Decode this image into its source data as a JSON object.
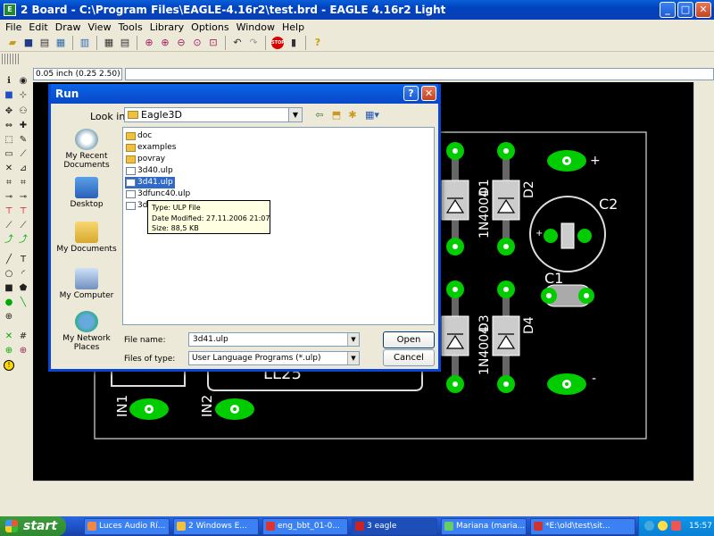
{
  "window": {
    "title": "2 Board - C:\\Program Files\\EAGLE-4.16r2\\test.brd - EAGLE 4.16r2 Light"
  },
  "menu": [
    "File",
    "Edit",
    "Draw",
    "View",
    "Tools",
    "Library",
    "Options",
    "Window",
    "Help"
  ],
  "coord_readout": "0.05 inch (0.25 2.50)",
  "pcb": {
    "labels": {
      "d1": "1N4004",
      "d1_ref": "D1",
      "d2_ref": "D2",
      "c2": "C2",
      "c1": "C1",
      "d3": "1N4004",
      "d3_ref": "D3",
      "d4_ref": "D4",
      "plus": "+",
      "minus": "-",
      "in1": "IN1",
      "in2": "IN2",
      "ll": "LL25"
    }
  },
  "dialog": {
    "title": "Run",
    "look_in_label": "Look in:",
    "look_in_value": "Eagle3D",
    "places": [
      "My Recent Documents",
      "Desktop",
      "My Documents",
      "My Computer",
      "My Network Places"
    ],
    "files": [
      {
        "name": "doc",
        "type": "folder"
      },
      {
        "name": "examples",
        "type": "folder"
      },
      {
        "name": "povray",
        "type": "folder"
      },
      {
        "name": "3d40.ulp",
        "type": "file"
      },
      {
        "name": "3d41.ulp",
        "type": "file",
        "selected": true
      },
      {
        "name": "3dfunc40.ulp",
        "type": "file"
      },
      {
        "name": "3df",
        "type": "file"
      }
    ],
    "tooltip": {
      "type": "Type: ULP File",
      "modified": "Date Modified: 27.11.2006 21:07",
      "size": "Size: 88,5 KB"
    },
    "file_name_label": "File name:",
    "file_name_value": "3d41.ulp",
    "files_of_type_label": "Files of type:",
    "files_of_type_value": "User Language Programs (*.ulp)",
    "open_label": "Open",
    "cancel_label": "Cancel"
  },
  "taskbar": {
    "start_label": "start",
    "tasks": [
      "Luces Audio Rí...",
      "2 Windows E...",
      "eng_bbt_01-0...",
      "3 eagle",
      "Mariana (maria...",
      "*E:\\old\\test\\sit..."
    ],
    "clock": "15:57"
  }
}
